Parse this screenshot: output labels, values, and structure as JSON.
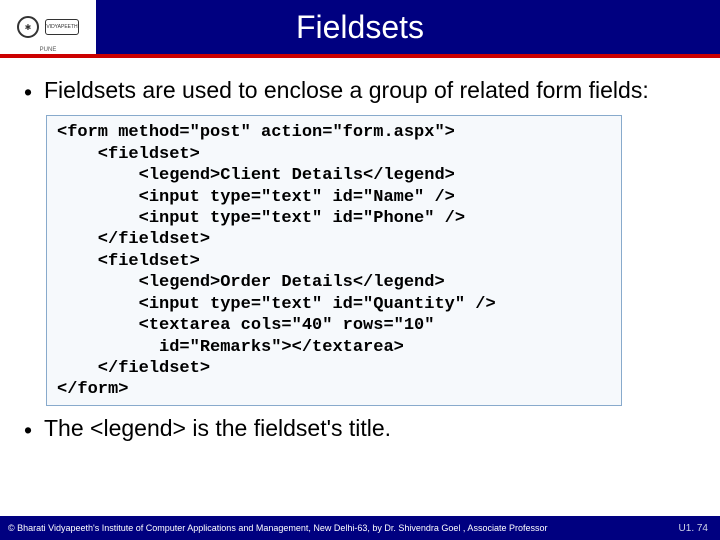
{
  "header": {
    "title": "Fieldsets",
    "logo_banner": "VIDYAPEETH",
    "logo_sub": "PUNE"
  },
  "bullets": {
    "b1": "Fieldsets are used to enclose a group of related form fields:",
    "b2": "The <legend> is the fieldset's title."
  },
  "code": "<form method=\"post\" action=\"form.aspx\">\n    <fieldset>\n        <legend>Client Details</legend>\n        <input type=\"text\" id=\"Name\" />\n        <input type=\"text\" id=\"Phone\" />\n    </fieldset>\n    <fieldset>\n        <legend>Order Details</legend>\n        <input type=\"text\" id=\"Quantity\" />\n        <textarea cols=\"40\" rows=\"10\"\n          id=\"Remarks\"></textarea>\n    </fieldset>\n</form>",
  "footer": {
    "copyright": "© Bharati Vidyapeeth's Institute of Computer Applications and Management, New Delhi-63, by Dr. Shivendra Goel , Associate Professor",
    "pagenum": "U1. 74"
  }
}
